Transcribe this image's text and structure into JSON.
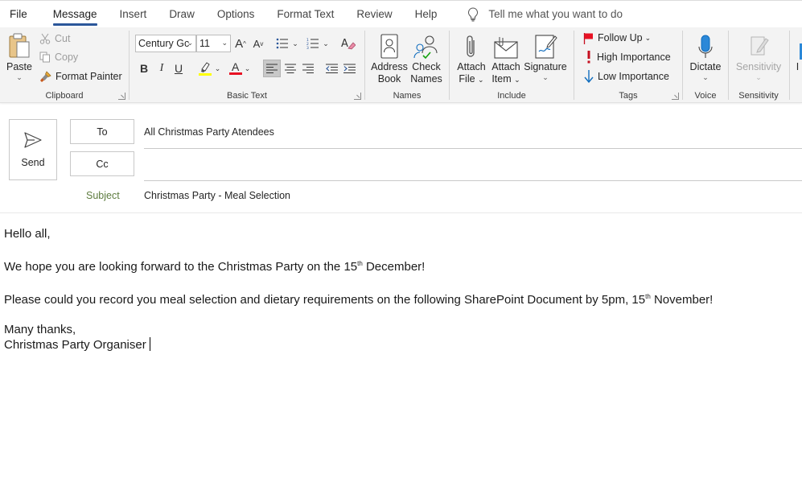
{
  "menu": {
    "tabs": [
      "File",
      "Message",
      "Insert",
      "Draw",
      "Options",
      "Format Text",
      "Review",
      "Help"
    ],
    "active_tab": "Message",
    "tell_me": "Tell me what you want to do"
  },
  "ribbon": {
    "clipboard": {
      "label": "Clipboard",
      "paste": "Paste",
      "cut": "Cut",
      "copy": "Copy",
      "format_painter": "Format Painter"
    },
    "basic_text": {
      "label": "Basic Text",
      "font_name": "Century Gc",
      "font_size": "11",
      "grow_font": "A",
      "shrink_font": "A",
      "bold": "B",
      "italic": "I",
      "underline": "U",
      "font_color_glyph": "A",
      "highlight_color": "#ffff00",
      "font_color": "#e81123"
    },
    "names": {
      "label": "Names",
      "address_book_1": "Address",
      "address_book_2": "Book",
      "check_names_1": "Check",
      "check_names_2": "Names"
    },
    "include": {
      "label": "Include",
      "attach_file_1": "Attach",
      "attach_file_2": "File",
      "attach_item_1": "Attach",
      "attach_item_2": "Item",
      "signature": "Signature"
    },
    "tags": {
      "label": "Tags",
      "follow_up": "Follow Up",
      "high_importance": "High Importance",
      "low_importance": "Low Importance"
    },
    "voice": {
      "label": "Voice",
      "dictate": "Dictate"
    },
    "sensitivity": {
      "label": "Sensitivity",
      "button": "Sensitivity"
    },
    "cut_off_label": "I"
  },
  "header": {
    "send_label": "Send",
    "to_label": "To",
    "cc_label": "Cc",
    "subject_label": "Subject",
    "to_value": "All Christmas Party Atendees",
    "cc_value": "",
    "subject_value": "Christmas Party - Meal Selection"
  },
  "body": {
    "greeting": "Hello all,",
    "line1_a": "We hope you are looking forward to the Christmas Party on the 15",
    "line1_sup": "th",
    "line1_b": " December!",
    "line2_a": "Please could you record you meal selection and dietary requirements on the following SharePoint Document by 5pm, 15",
    "line2_sup": "th",
    "line2_b": " November!",
    "signoff": "Many thanks,",
    "signature": "Christmas Party Organiser"
  },
  "colors": {
    "accent": "#2b579a",
    "subject_label": "#5e7c3f",
    "importance_high": "#c50f1f",
    "importance_low": "#0f6cbd"
  }
}
